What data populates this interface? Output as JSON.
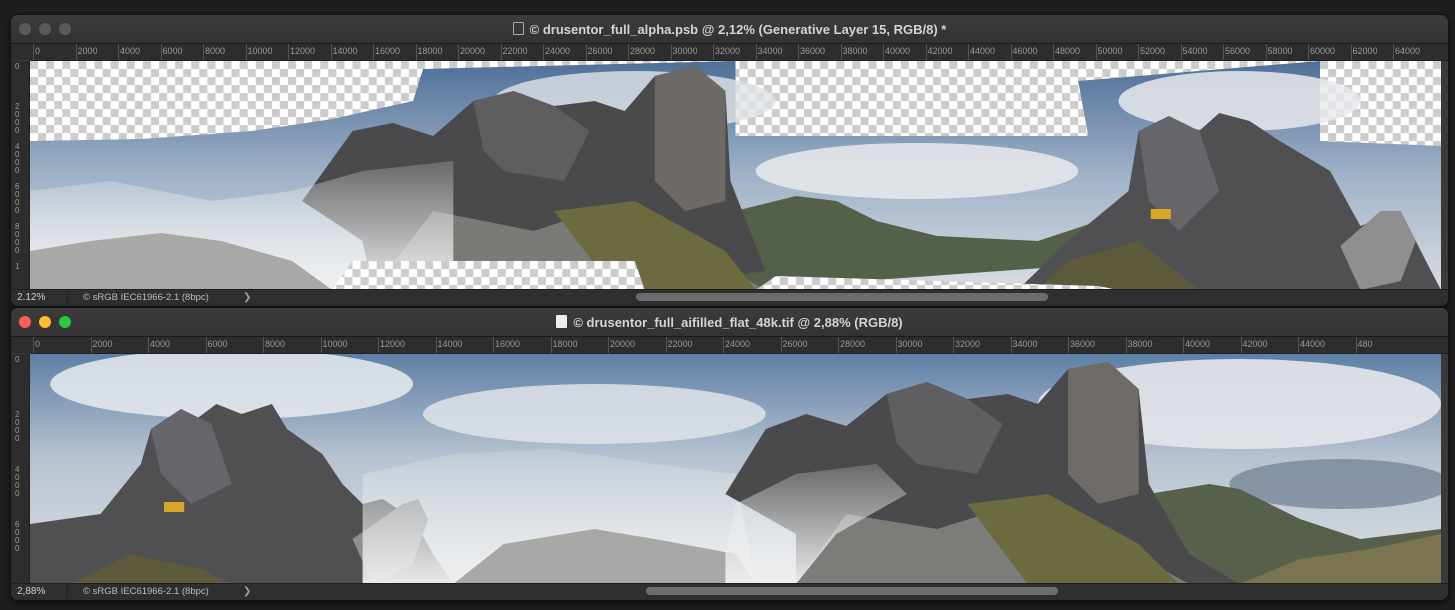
{
  "windows": [
    {
      "title": "© drusentor_full_alpha.psb @ 2,12% (Generative Layer 15, RGB/8) *",
      "ruler_labels": [
        "0",
        "2000",
        "4000",
        "6000",
        "8000",
        "10000",
        "12000",
        "14000",
        "16000",
        "18000",
        "20000",
        "22000",
        "24000",
        "26000",
        "28000",
        "30000",
        "32000",
        "34000",
        "36000",
        "38000",
        "40000",
        "42000",
        "44000",
        "46000",
        "48000",
        "50000",
        "52000",
        "54000",
        "56000",
        "58000",
        "60000",
        "62000",
        "64000"
      ],
      "vruler_labels": [
        "0",
        "2000",
        "4000",
        "6000",
        "8000",
        "1"
      ],
      "zoom": "2.12%",
      "color_profile": "© sRGB IEC61966-2.1 (8bpc)",
      "chevron": "❯",
      "canvas_description_icon": "panorama-with-transparency"
    },
    {
      "title": "© drusentor_full_aifilled_flat_48k.tif @ 2,88% (RGB/8)",
      "ruler_labels": [
        "0",
        "2000",
        "4000",
        "6000",
        "8000",
        "10000",
        "12000",
        "14000",
        "16000",
        "18000",
        "20000",
        "22000",
        "24000",
        "26000",
        "28000",
        "30000",
        "32000",
        "34000",
        "36000",
        "38000",
        "40000",
        "42000",
        "44000",
        "480"
      ],
      "vruler_labels": [
        "0",
        "2000",
        "4000",
        "6000"
      ],
      "zoom": "2,88%",
      "color_profile": "© sRGB IEC61966-2.1 (8bpc)",
      "chevron": "❯",
      "canvas_description_icon": "panorama-filled"
    }
  ],
  "colors": {
    "sky_blue": "#5d7fa6",
    "cloud": "#d9dde2",
    "rock": "#4d4d4f",
    "rock_light": "#8a8a8c",
    "grass": "#6f6a3a",
    "warning_sign": "#d8a628"
  }
}
